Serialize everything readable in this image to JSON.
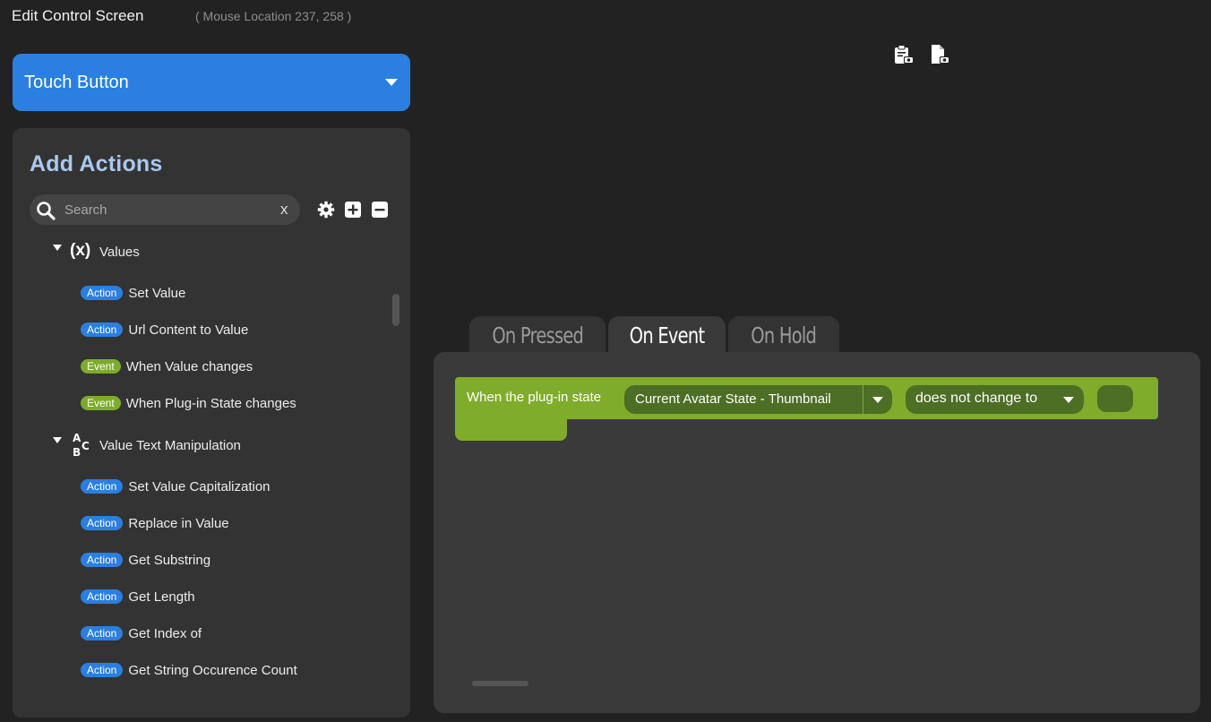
{
  "window": {
    "title": "Edit Control Screen",
    "mouse_location": "( Mouse Location 237, 258 )"
  },
  "control_type": {
    "selected": "Touch Button"
  },
  "actions_panel": {
    "title": "Add Actions",
    "search": {
      "placeholder": "Search",
      "value": "",
      "clear_label": "x"
    },
    "tools": [
      "gear-icon",
      "plus-square-icon",
      "minus-square-icon"
    ],
    "groups": [
      {
        "name": "Values",
        "icon_text": "(x)",
        "items": [
          {
            "badge": "Action",
            "label": "Set Value"
          },
          {
            "badge": "Action",
            "label": "Url Content to Value"
          },
          {
            "badge": "Event",
            "label": "When Value changes"
          },
          {
            "badge": "Event",
            "label": "When Plug-in State changes"
          }
        ]
      },
      {
        "name": "Value Text Manipulation",
        "icon_text": "ABC",
        "items": [
          {
            "badge": "Action",
            "label": "Set Value Capitalization"
          },
          {
            "badge": "Action",
            "label": "Replace in Value"
          },
          {
            "badge": "Action",
            "label": "Get Substring"
          },
          {
            "badge": "Action",
            "label": "Get Length"
          },
          {
            "badge": "Action",
            "label": "Get Index of"
          },
          {
            "badge": "Action",
            "label": "Get String Occurence Count"
          }
        ]
      }
    ]
  },
  "tabs": [
    {
      "label": "On Pressed",
      "active": false
    },
    {
      "label": "On Event",
      "active": true
    },
    {
      "label": "On Hold",
      "active": false
    }
  ],
  "event_block": {
    "prefix": "When the plug-in state",
    "state_dropdown": "Current Avatar State - Thumbnail",
    "condition_dropdown": "does not change to",
    "value": ""
  },
  "colors": {
    "background": "#222222",
    "panel": "#333333",
    "accent_blue": "#2a7fe0",
    "event_green": "#80ac2b",
    "title_blue": "#a9c8ef"
  }
}
